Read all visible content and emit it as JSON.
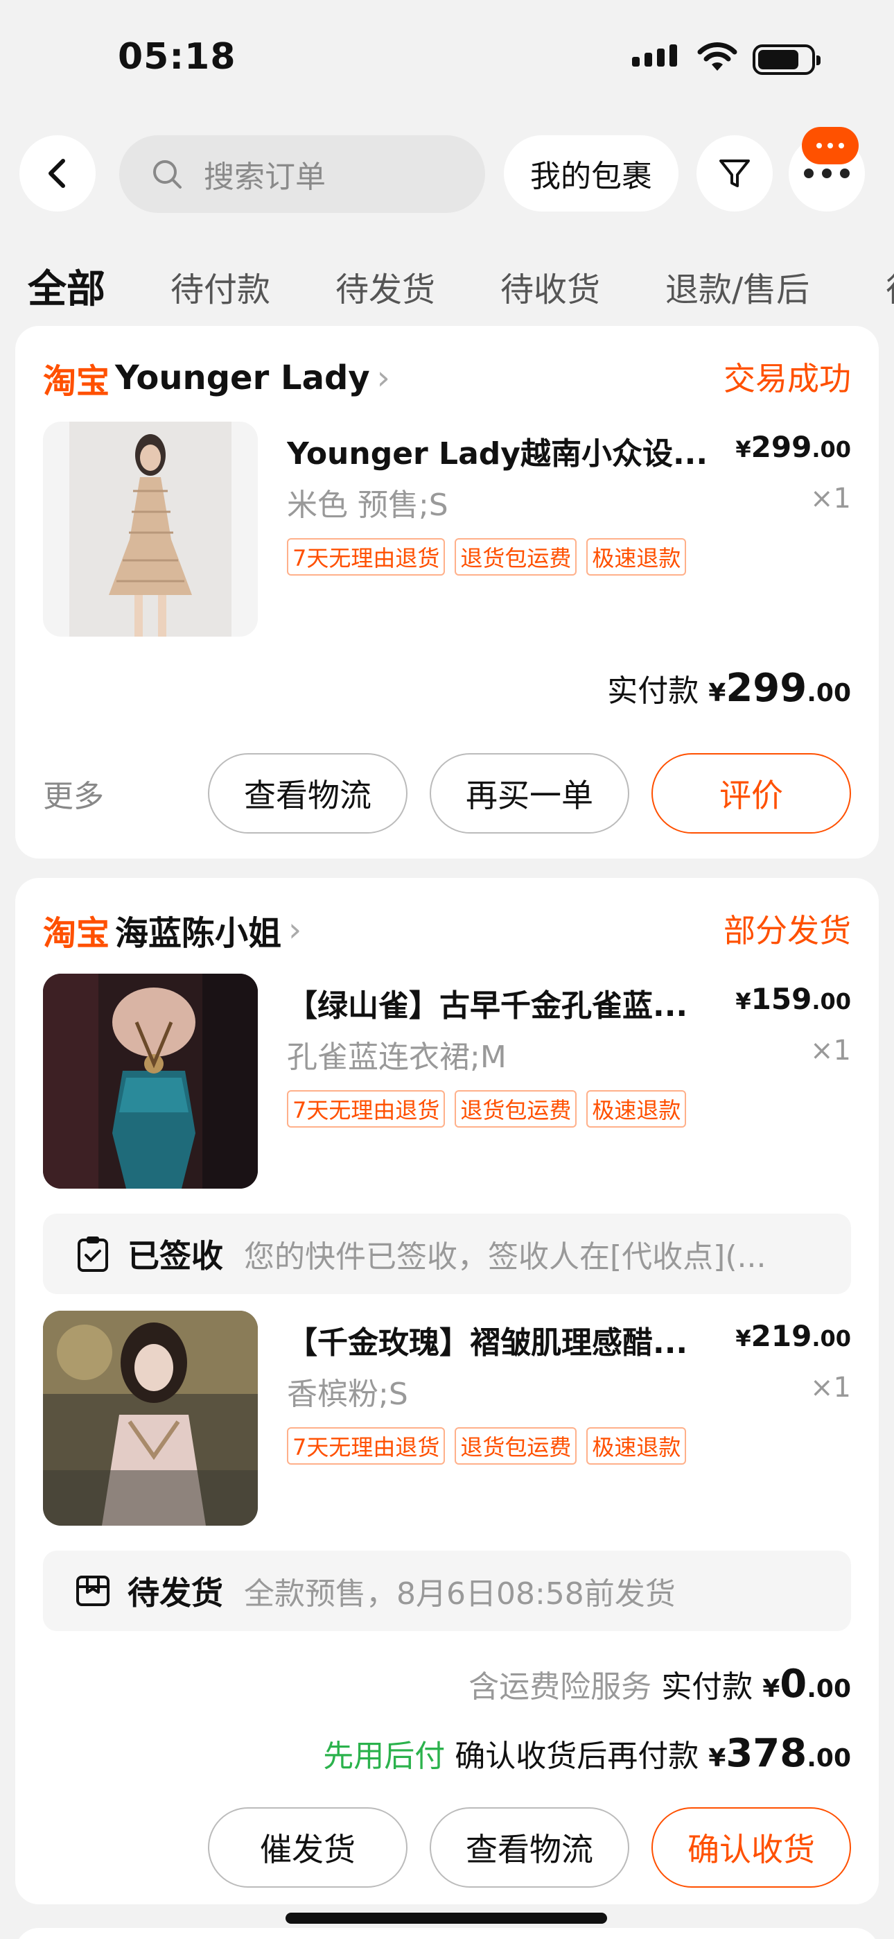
{
  "status": {
    "time": "05:18"
  },
  "search": {
    "placeholder": "搜索订单"
  },
  "toolbar": {
    "my_packages": "我的包裹"
  },
  "tabs": [
    "全部",
    "待付款",
    "待发货",
    "待收货",
    "退款/售后",
    "待"
  ],
  "orders": [
    {
      "platform": "淘宝",
      "shop": "Younger Lady",
      "status": "交易成功",
      "items": [
        {
          "title": "Younger Lady越南小众设...",
          "price_main": "299",
          "price_dec": ".00",
          "sku": "米色 预售;S",
          "qty": "×1",
          "tags": [
            "7天无理由退货",
            "退货包运费",
            "极速退款"
          ]
        }
      ],
      "paid_label": "实付款",
      "paid_main": "299",
      "paid_dec": ".00",
      "more": "更多",
      "buttons": [
        "查看物流",
        "再买一单",
        "评价"
      ]
    },
    {
      "platform": "淘宝",
      "shop": "海蓝陈小姐",
      "status": "部分发货",
      "items": [
        {
          "title": "【绿山雀】古早千金孔雀蓝...",
          "price_main": "159",
          "price_dec": ".00",
          "sku": "孔雀蓝连衣裙;M",
          "qty": "×1",
          "tags": [
            "7天无理由退货",
            "退货包运费",
            "极速退款"
          ]
        },
        {
          "title": "【千金玫瑰】褶皱肌理感醋...",
          "price_main": "219",
          "price_dec": ".00",
          "sku": "香槟粉;S",
          "qty": "×1",
          "tags": [
            "7天无理由退货",
            "退货包运费",
            "极速退款"
          ]
        }
      ],
      "notice1": {
        "label": "已签收",
        "text": "您的快件已签收，签收人在[代收点](..."
      },
      "notice2": {
        "label": "待发货",
        "text": "全款预售，8月6日08:58前发货"
      },
      "insurance": "含运费险服务",
      "paid_label": "实付款",
      "paid_main": "0",
      "paid_dec": ".00",
      "later_label": "先用后付",
      "later_text": "确认收货后再付款",
      "later_main": "378",
      "later_dec": ".00",
      "buttons": [
        "催发货",
        "查看物流",
        "确认收货"
      ]
    }
  ],
  "colors": {
    "accent": "#ff5000",
    "green": "#2bb24c"
  },
  "currency": "¥"
}
